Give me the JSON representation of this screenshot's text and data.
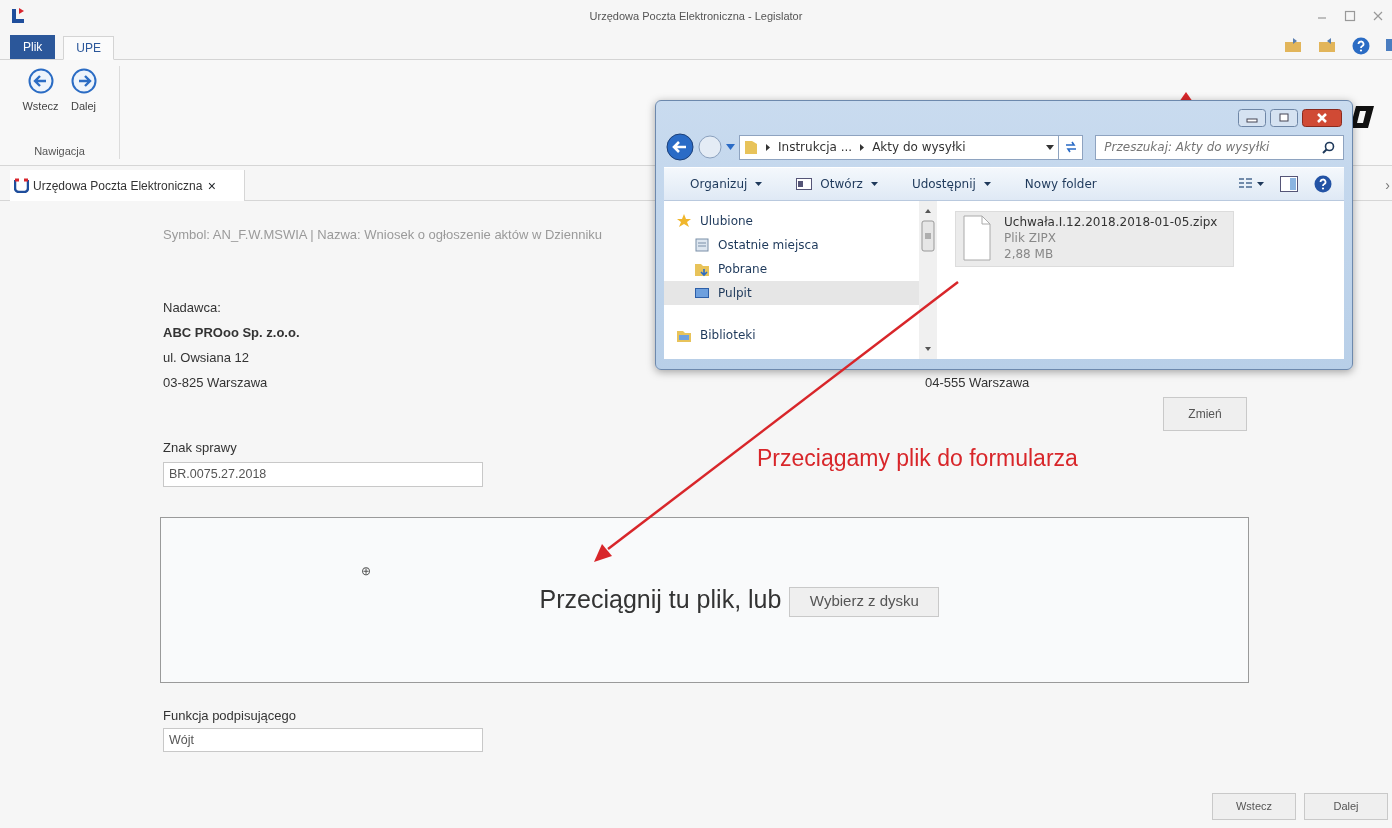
{
  "app": {
    "title": "Urzędowa Poczta Elektroniczna - Legislator"
  },
  "ribbon_tabs": [
    {
      "label": "Plik",
      "kind": "file",
      "selected": false
    },
    {
      "label": "UPE",
      "kind": "tab",
      "selected": true
    }
  ],
  "ribbon_group": {
    "label": "Nawigacja",
    "buttons": [
      {
        "label": "Wstecz",
        "kind": "back"
      },
      {
        "label": "Dalej",
        "kind": "forward"
      }
    ]
  },
  "document_tabs": [
    {
      "label": "Urzędowa Poczta Elektroniczna",
      "selected": true,
      "close": "×"
    }
  ],
  "tab_scroll": "›",
  "form": {
    "symbol_line": "Symbol: AN_F.W.MSWIA | Nazwa: Wniosek o ogłoszenie aktów w Dzienniku",
    "sender": {
      "label": "Nadawca:",
      "name": "ABC PROoo Sp. z.o.o.",
      "street": "ul. Owsiana 12",
      "city": "03-825 Warszawa"
    },
    "recipient": {
      "city": "04-555 Warszawa"
    },
    "change_button": "Zmień",
    "case_number": {
      "label": "Znak sprawy",
      "value": "BR.0075.27.2018"
    },
    "drop_zone": {
      "marker": "⊕",
      "text": "Przeciągnij tu plik, lub",
      "button": "Wybierz z dysku"
    },
    "signer_function": {
      "label": "Funkcja podpisującego",
      "value": "Wójt"
    }
  },
  "footer_buttons": [
    "Wstecz",
    "Dalej"
  ],
  "annotation": {
    "text": "Przeciągamy plik do formularza"
  },
  "explorer": {
    "breadcrumbs": [
      "Instrukcja ...",
      "Akty do wysyłki"
    ],
    "search": {
      "placeholder": "Przeszukaj: Akty do wysyłki"
    },
    "toolbar": [
      {
        "label": "Organizuj",
        "kind": "menu"
      },
      {
        "label": "Otwórz",
        "kind": "open"
      },
      {
        "label": "Udostępnij",
        "kind": "menu"
      },
      {
        "label": "Nowy folder",
        "kind": "plain"
      }
    ],
    "nav": [
      {
        "label": "Ulubione",
        "kind": "favorites",
        "selected": false,
        "children": [
          {
            "label": "Ostatnie miejsca",
            "kind": "recent",
            "selected": false
          },
          {
            "label": "Pobrane",
            "kind": "downloads",
            "selected": false
          },
          {
            "label": "Pulpit",
            "kind": "desktop",
            "selected": true
          }
        ]
      },
      {
        "label": "Biblioteki",
        "kind": "libraries",
        "selected": false
      }
    ],
    "files": [
      {
        "name": "Uchwała.I.12.2018.2018-01-05.zipx",
        "type": "Plik ZIPX",
        "size": "2,88 MB",
        "selected": true
      }
    ]
  }
}
